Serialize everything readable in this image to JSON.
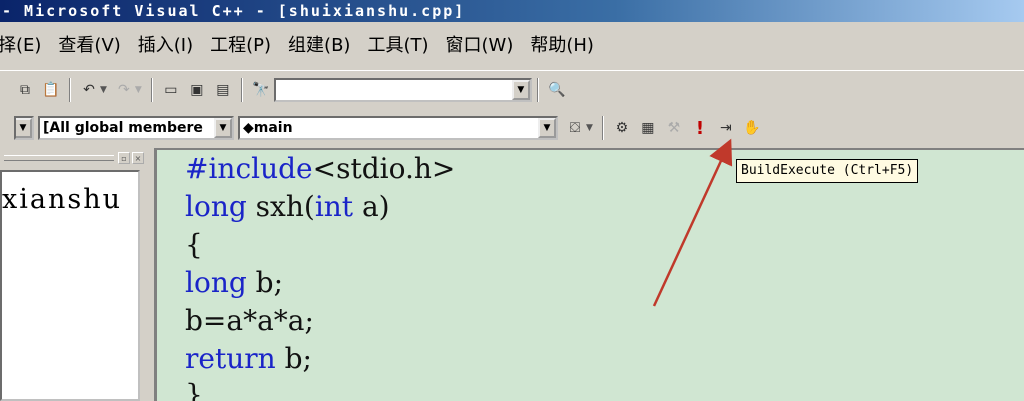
{
  "window": {
    "title": "- Microsoft Visual C++ - [shuixianshu.cpp]"
  },
  "menu": {
    "items": [
      {
        "label": "择(E)"
      },
      {
        "label": "查看(V)"
      },
      {
        "label": "插入(I)"
      },
      {
        "label": "工程(P)"
      },
      {
        "label": "组建(B)"
      },
      {
        "label": "工具(T)"
      },
      {
        "label": "窗口(W)"
      },
      {
        "label": "帮助(H)"
      }
    ]
  },
  "toolbar2": {
    "scope_combo": "[All global membere",
    "function_combo": "◆main"
  },
  "workspace": {
    "tree_label": "xianshu"
  },
  "editor": {
    "lines": [
      {
        "kw": "#include",
        "rest": "<stdio.h>"
      },
      {
        "kw": "long",
        "rest": " sxh(",
        "kw2": "int",
        "rest2": " a)"
      },
      {
        "kw": "",
        "rest": "{"
      },
      {
        "kw": "long",
        "rest": " b;"
      },
      {
        "kw": "",
        "rest": "b=a*a*a;"
      },
      {
        "kw": "return",
        "rest": " b;"
      },
      {
        "kw": "",
        "rest": "}"
      }
    ]
  },
  "tooltip": {
    "text": "BuildExecute (Ctrl+F5)"
  },
  "colors": {
    "editor_bg": "#d0e6d2",
    "keyword": "#1a24c8",
    "arrow": "#c0392b"
  }
}
